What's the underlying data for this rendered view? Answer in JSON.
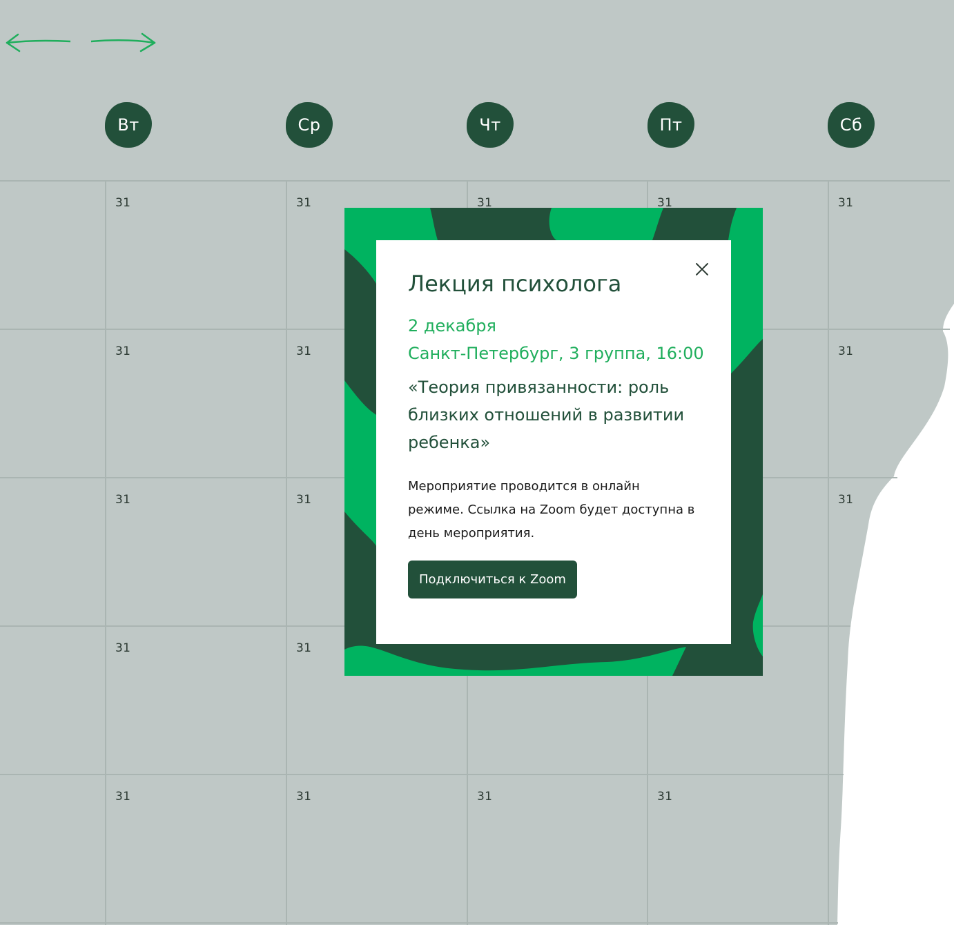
{
  "colors": {
    "background_gray": "#bfc8c6",
    "grid_line": "#aab5b2",
    "dark_green": "#22503a",
    "accent_green": "#00b360",
    "meta_green": "#1fae5c",
    "white": "#ffffff"
  },
  "nav": {
    "prev_icon": "arrow-left-icon",
    "next_icon": "arrow-right-icon"
  },
  "weekdays": [
    "Вт",
    "Ср",
    "Чт",
    "Пт",
    "Сб"
  ],
  "calendar": {
    "visible_day_numbers": [
      "31",
      "31",
      "31",
      "31",
      "31"
    ]
  },
  "modal": {
    "title": "Лекция психолога",
    "date": "2 декабря",
    "location": "Санкт-Петербург, 3 группа, 16:00",
    "subtitle": "«Теория привязанности: роль близких отношений в развитии ребенка»",
    "description": "Мероприятие проводится в онлайн режиме. Ссылка на Zoom будет доступна в день мероприятия.",
    "button_label": "Подключиться к Zoom",
    "close_icon": "close-icon"
  }
}
